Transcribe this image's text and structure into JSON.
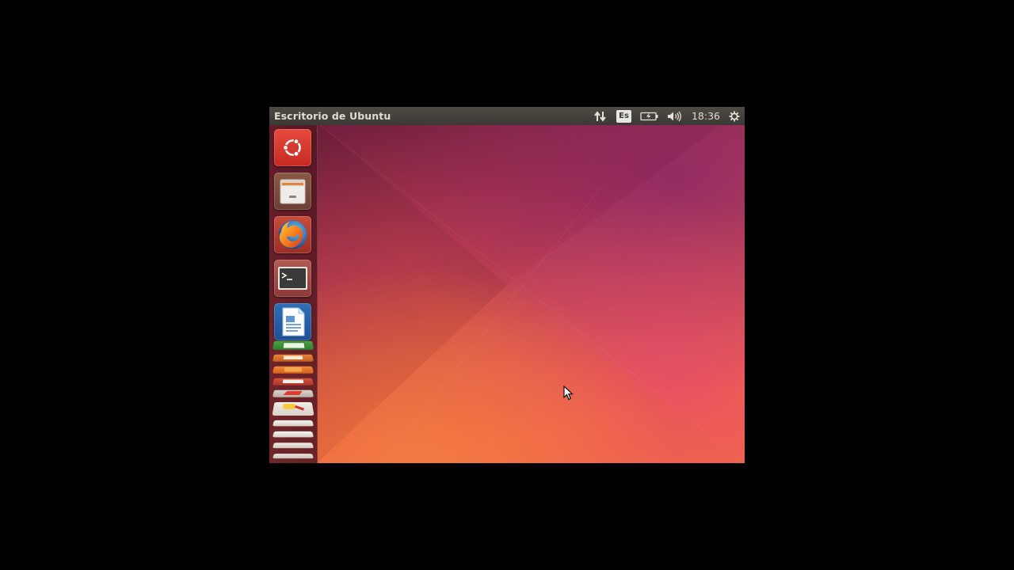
{
  "panel": {
    "title": "Escritorio de Ubuntu",
    "keyboard_layout": "Es",
    "clock": "18:36"
  },
  "panel_icons": [
    "network-transfer-icon",
    "keyboard-layout-indicator",
    "battery-icon",
    "volume-icon",
    "session-gear-icon"
  ],
  "launcher": {
    "items": [
      {
        "name": "ubuntu-dash-button",
        "icon": "ubuntu-logo-icon"
      },
      {
        "name": "files-launcher",
        "icon": "file-cabinet-icon"
      },
      {
        "name": "firefox-launcher",
        "icon": "firefox-icon"
      },
      {
        "name": "terminal-launcher",
        "icon": "terminal-icon"
      },
      {
        "name": "libreoffice-writer-launcher",
        "icon": "writer-document-icon"
      }
    ],
    "folded_items": [
      "libreoffice-calc-launcher",
      "libreoffice-impress-launcher",
      "software-center-launcher",
      "amazon-launcher",
      "text-editor-launcher",
      "image-viewer-launcher",
      "generic-app-launcher",
      "generic-app-launcher",
      "generic-app-launcher",
      "generic-app-launcher"
    ]
  },
  "colors": {
    "panel": "#3c3b37",
    "launcher": "#5e1d26",
    "wallpaper_top": "#6e1d3a",
    "wallpaper_bottom": "#f0673f",
    "ubuntu_orange": "#dd4814"
  }
}
